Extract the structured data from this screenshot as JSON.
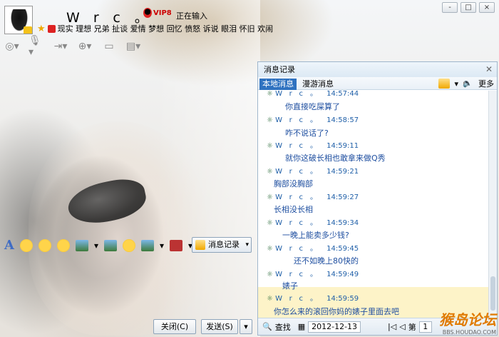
{
  "header": {
    "nickname": "　Wrc。",
    "vip_label": "VIP8",
    "typing_status": "正在输入",
    "signature": "现实 理想 兄弟 扯谈 爱情 梦想 回忆 愤怒 诉说 眼泪 怀旧 欢闹"
  },
  "window_controls": [
    "-",
    "□",
    "×"
  ],
  "history": {
    "title": "消息记录",
    "tabs": [
      "本地消息",
      "漫游消息"
    ],
    "more_label": "更多",
    "messages": [
      {
        "sender": "Wrc。",
        "time": "14:57:44",
        "text": "你直接吃屎算了"
      },
      {
        "sender": "Wrc。",
        "time": "14:58:57",
        "text": "咋不说话了?"
      },
      {
        "sender": "Wrc。",
        "time": "14:59:11",
        "text": "就你这破长相也敢拿来做Q秀"
      },
      {
        "sender": "Wrc。",
        "time": "14:59:21",
        "text": "胸部没胸部"
      },
      {
        "sender": "Wrc。",
        "time": "14:59:27",
        "text": "长相没长相"
      },
      {
        "sender": "Wrc。",
        "time": "14:59:34",
        "text": "一晚上能卖多少钱?"
      },
      {
        "sender": "Wrc。",
        "time": "14:59:45",
        "text": "还不如晚上80快的"
      },
      {
        "sender": "Wrc。",
        "time": "14:59:49",
        "text": "婊子"
      },
      {
        "sender": "Wrc。",
        "time": "14:59:59",
        "text": "你怎么来的滚回你妈的婊子里面去吧"
      }
    ],
    "footer": {
      "find_label": "查找",
      "date": "2012-12-13",
      "page_prefix": "第",
      "page_value": "1"
    }
  },
  "input_toolbar": {
    "font_label": "A",
    "history_button": "消息记录"
  },
  "buttons": {
    "close": "关闭(C)",
    "send": "发送(S)",
    "send_dropdown": "▾"
  },
  "watermark": {
    "title": "猴岛论坛",
    "sub": "BBS.HOUDAO.COM"
  }
}
